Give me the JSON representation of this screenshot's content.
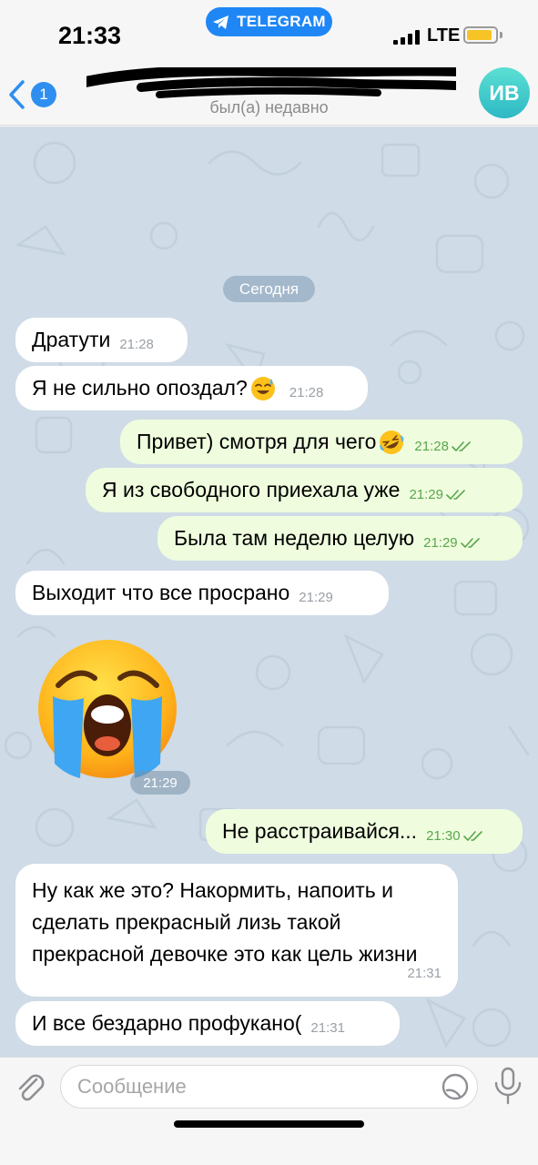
{
  "status_bar": {
    "time": "21:33",
    "app_pill": "TELEGRAM",
    "network": "LTE",
    "battery_level": 0.9
  },
  "header": {
    "back_badge": "1",
    "contact_status": "был(а) недавно",
    "avatar_initials": "ИВ",
    "avatar_color": "#3cc6c9"
  },
  "chat": {
    "date_chip": "Сегодня",
    "messages": [
      {
        "text": "Дратути",
        "time": "21:28"
      },
      {
        "text": "Я не сильно опоздал?",
        "emoji": "sweat-smile-emoji",
        "time": "21:28"
      },
      {
        "text": "Привет) смотря для чего",
        "emoji": "rofl-emoji",
        "time": "21:28"
      },
      {
        "text": "Я из свободного приехала уже",
        "time": "21:29"
      },
      {
        "text": "Была там неделю целую",
        "time": "21:29"
      },
      {
        "text": "Выходит что все просрано",
        "time": "21:29"
      },
      {
        "sticker": "loudly-crying-face-sticker",
        "time": "21:29"
      },
      {
        "text": "Не расстраивайся...",
        "time": "21:30"
      },
      {
        "text": "Ну как же это? Накормить, напоить и сделать прекрасный лизь такой прекрасной девочке это как цель жизни",
        "time": "21:31"
      },
      {
        "text": "И все бездарно профукано(",
        "time": "21:31"
      }
    ]
  },
  "input": {
    "placeholder": "Сообщение"
  },
  "colors": {
    "accent": "#2f8ff0",
    "incoming_bubble": "#ffffff",
    "outgoing_bubble": "#effdde",
    "read_tick": "#5aa64d",
    "chat_background": "#cfdbe6"
  }
}
